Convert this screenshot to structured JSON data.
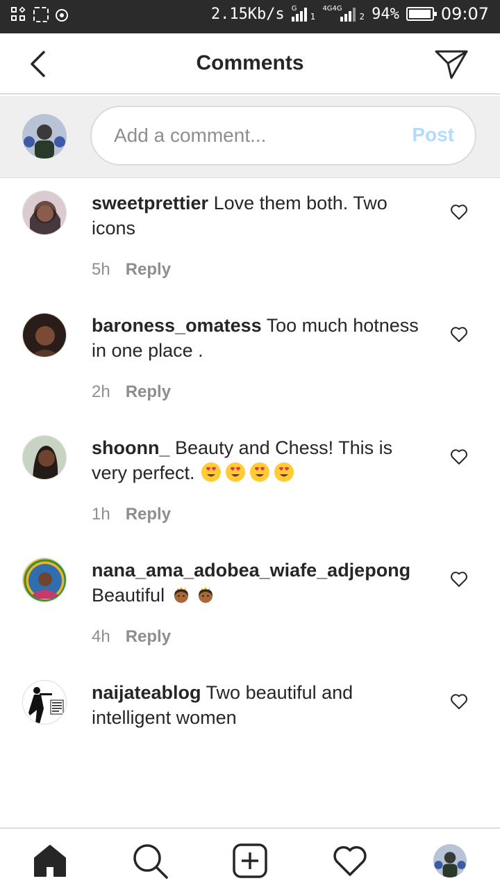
{
  "status_bar": {
    "net_speed": "2.15Kb/s",
    "sim1_label": "G",
    "sim1_sub": "1",
    "sim2_label": "4G4G",
    "sim2_sub": "2",
    "battery": "94%",
    "time": "09:07"
  },
  "header": {
    "title": "Comments",
    "back_icon": "chevron-left-icon",
    "share_icon": "paper-plane-icon"
  },
  "composer": {
    "placeholder": "Add a comment...",
    "post_label": "Post",
    "post_color": "#b3dbff"
  },
  "comments": [
    {
      "user": "sweetprettier",
      "text": "Love them both. Two icons",
      "emoji": [],
      "time": "5h",
      "reply": "Reply"
    },
    {
      "user": "baroness_omatess",
      "text": "Too much hotness in one place .",
      "emoji": [],
      "time": "2h",
      "reply": "Reply"
    },
    {
      "user": "shoonn_",
      "text": "Beauty and Chess! This is very perfect.",
      "emoji": [
        "heart-eyes",
        "heart-eyes",
        "heart-eyes",
        "heart-eyes"
      ],
      "time": "1h",
      "reply": "Reply"
    },
    {
      "user": "nana_ama_adobea_wiafe_adjepong",
      "text": "Beautiful",
      "emoji": [
        "princess",
        "princess"
      ],
      "time": "4h",
      "reply": "Reply"
    },
    {
      "user": "naijateablog",
      "text": "Two beautiful and intelligent women",
      "emoji": [],
      "time": "",
      "reply": ""
    }
  ],
  "bottom_nav": {
    "items": [
      "home-icon",
      "search-icon",
      "add-post-icon",
      "activity-heart-icon",
      "profile-avatar"
    ]
  },
  "colors": {
    "primary_text": "#262626",
    "secondary_text": "#8e8e8e",
    "divider": "#dbdbdb",
    "composer_bg": "#efefef",
    "status_bar_bg": "#2b2b2b"
  }
}
